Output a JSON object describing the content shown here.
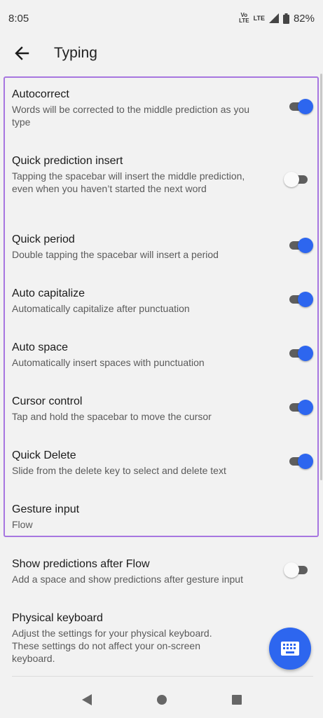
{
  "status_bar": {
    "time": "8:05",
    "volte_top": "Vo",
    "volte_bottom": "LTE",
    "lte_label": "LTE",
    "battery_percent": "82%"
  },
  "app_bar": {
    "title": "Typing"
  },
  "settings": [
    {
      "title": "Autocorrect",
      "desc": "Words will be corrected to the middle prediction as you type",
      "enabled": true
    },
    {
      "title": "Quick prediction insert",
      "desc": "Tapping the spacebar will insert the middle prediction, even when you haven’t started the next word",
      "enabled": false
    },
    {
      "title": "Quick period",
      "desc": "Double tapping the spacebar will insert a period",
      "enabled": true
    },
    {
      "title": "Auto capitalize",
      "desc": "Automatically capitalize after punctuation",
      "enabled": true
    },
    {
      "title": "Auto space",
      "desc": "Automatically insert spaces with punctuation",
      "enabled": true
    },
    {
      "title": "Cursor control",
      "desc": "Tap and hold the spacebar to move the cursor",
      "enabled": true
    },
    {
      "title": "Quick Delete",
      "desc": "Slide from the delete key to select and delete text",
      "enabled": true
    },
    {
      "title": "Gesture input",
      "desc": "Flow"
    },
    {
      "title": "Show predictions after Flow",
      "desc": "Add a space and show predictions after gesture input",
      "enabled": false
    },
    {
      "title": "Physical keyboard",
      "desc": "Adjust the settings for your physical keyboard. These settings do not affect your on-screen keyboard."
    }
  ],
  "colors": {
    "accent": "#2d66ef",
    "highlight": "#a776e0"
  },
  "icons": {
    "back": "back-arrow-icon",
    "fab": "keyboard-icon",
    "nav_back": "nav-back-icon",
    "nav_home": "nav-home-icon",
    "nav_recents": "nav-recents-icon"
  }
}
